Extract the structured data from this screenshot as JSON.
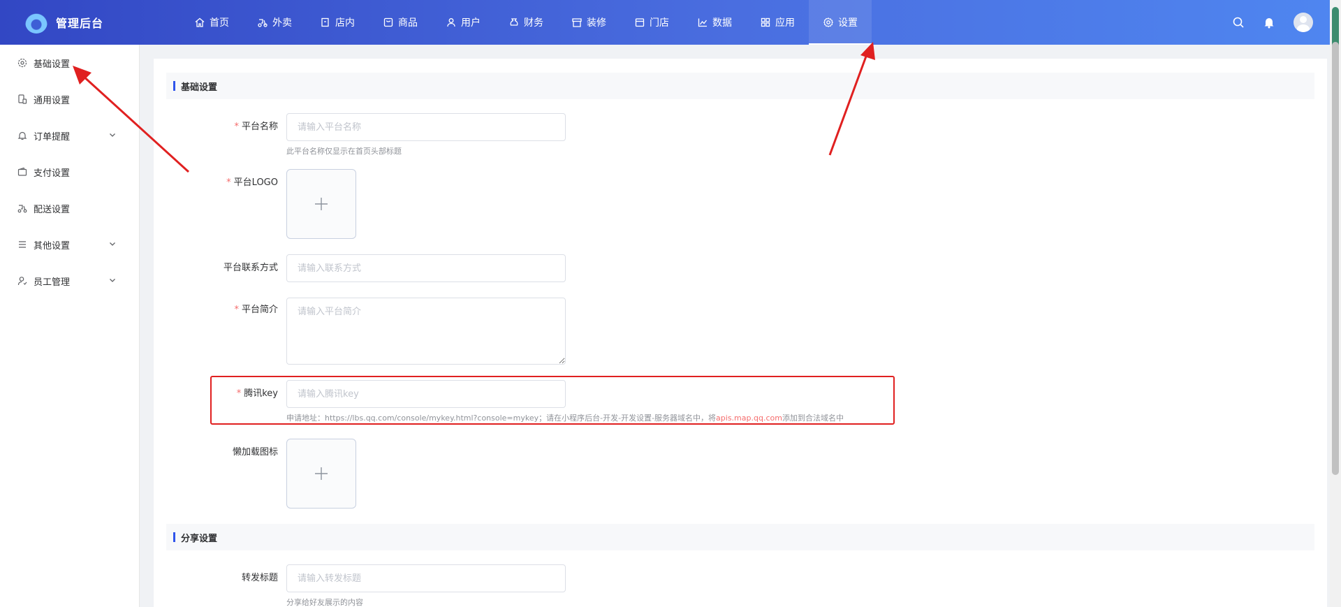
{
  "header": {
    "brand_title": "管理后台",
    "nav": [
      {
        "label": "首页",
        "icon": "home-icon"
      },
      {
        "label": "外卖",
        "icon": "scooter-icon"
      },
      {
        "label": "店内",
        "icon": "store-icon"
      },
      {
        "label": "商品",
        "icon": "goods-icon"
      },
      {
        "label": "用户",
        "icon": "user-icon"
      },
      {
        "label": "财务",
        "icon": "money-icon"
      },
      {
        "label": "装修",
        "icon": "decor-icon"
      },
      {
        "label": "门店",
        "icon": "shop-icon"
      },
      {
        "label": "数据",
        "icon": "chart-icon"
      },
      {
        "label": "应用",
        "icon": "apps-icon"
      },
      {
        "label": "设置",
        "icon": "gear-icon"
      }
    ],
    "active_nav": "设置"
  },
  "sidebar": {
    "items": [
      {
        "label": "基础设置",
        "icon": "gear-icon",
        "expandable": false
      },
      {
        "label": "通用设置",
        "icon": "device-icon",
        "expandable": false
      },
      {
        "label": "订单提醒",
        "icon": "bell-icon",
        "expandable": true
      },
      {
        "label": "支付设置",
        "icon": "wallet-icon",
        "expandable": false
      },
      {
        "label": "配送设置",
        "icon": "delivery-icon",
        "expandable": false
      },
      {
        "label": "其他设置",
        "icon": "list-icon",
        "expandable": true
      },
      {
        "label": "员工管理",
        "icon": "staff-icon",
        "expandable": true
      }
    ],
    "active": "基础设置"
  },
  "sections": {
    "basic": {
      "title": "基础设置"
    },
    "share": {
      "title": "分享设置"
    }
  },
  "form": {
    "platform_name": {
      "label": "平台名称",
      "required": true,
      "placeholder": "请输入平台名称",
      "value": "",
      "hint": "此平台名称仅显示在首页头部标题"
    },
    "platform_logo": {
      "label": "平台LOGO",
      "required": true
    },
    "platform_contact": {
      "label": "平台联系方式",
      "required": false,
      "placeholder": "请输入联系方式",
      "value": ""
    },
    "platform_intro": {
      "label": "平台简介",
      "required": true,
      "placeholder": "请输入平台简介",
      "value": ""
    },
    "tencent_key": {
      "label": "腾讯key",
      "required": true,
      "placeholder": "请输入腾讯key",
      "value": "",
      "hint_prefix": "申请地址：https://lbs.qq.com/console/mykey.html?console=mykey；请在小程序后台-开发-开发设置-服务器域名中，将",
      "hint_link": "apis.map.qq.com",
      "hint_suffix": "添加到合法域名中"
    },
    "lazyload_icon": {
      "label": "懒加载图标",
      "required": false
    },
    "share_title": {
      "label": "转发标题",
      "required": false,
      "placeholder": "请输入转发标题",
      "value": "",
      "hint": "分享给好友展示的内容"
    }
  },
  "required_mark": "*",
  "colors": {
    "accent": "#2f54eb",
    "header_start": "#3247c4",
    "header_end": "#4f86f0",
    "required": "#f56c6c",
    "annotation": "#e02020"
  }
}
